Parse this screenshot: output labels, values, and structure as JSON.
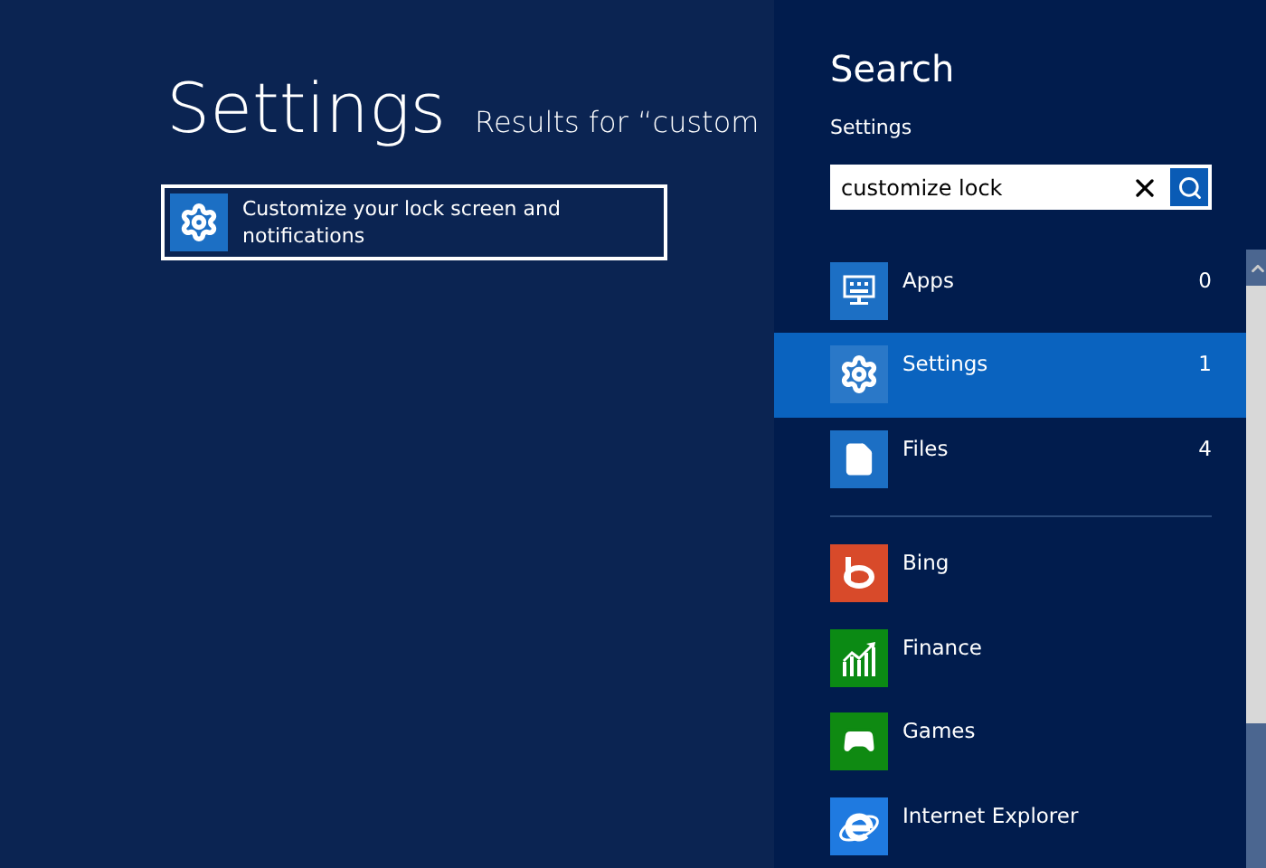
{
  "main": {
    "title": "Settings",
    "subtitle": "Results for “custom",
    "results": [
      {
        "label": "Customize your lock screen and notifications",
        "selected": true
      }
    ]
  },
  "search": {
    "title": "Search",
    "scope": "Settings",
    "value": "customize lock"
  },
  "categories": [
    {
      "label": "Apps",
      "count": "0",
      "selected": false
    },
    {
      "label": "Settings",
      "count": "1",
      "selected": true
    },
    {
      "label": "Files",
      "count": "4",
      "selected": false
    }
  ],
  "apps": [
    {
      "label": "Bing",
      "color": "#d84a2a"
    },
    {
      "label": "Finance",
      "color": "#0b8a14"
    },
    {
      "label": "Games",
      "color": "#0f8a12"
    },
    {
      "label": "Internet Explorer",
      "color": "#1f7ae0"
    }
  ]
}
